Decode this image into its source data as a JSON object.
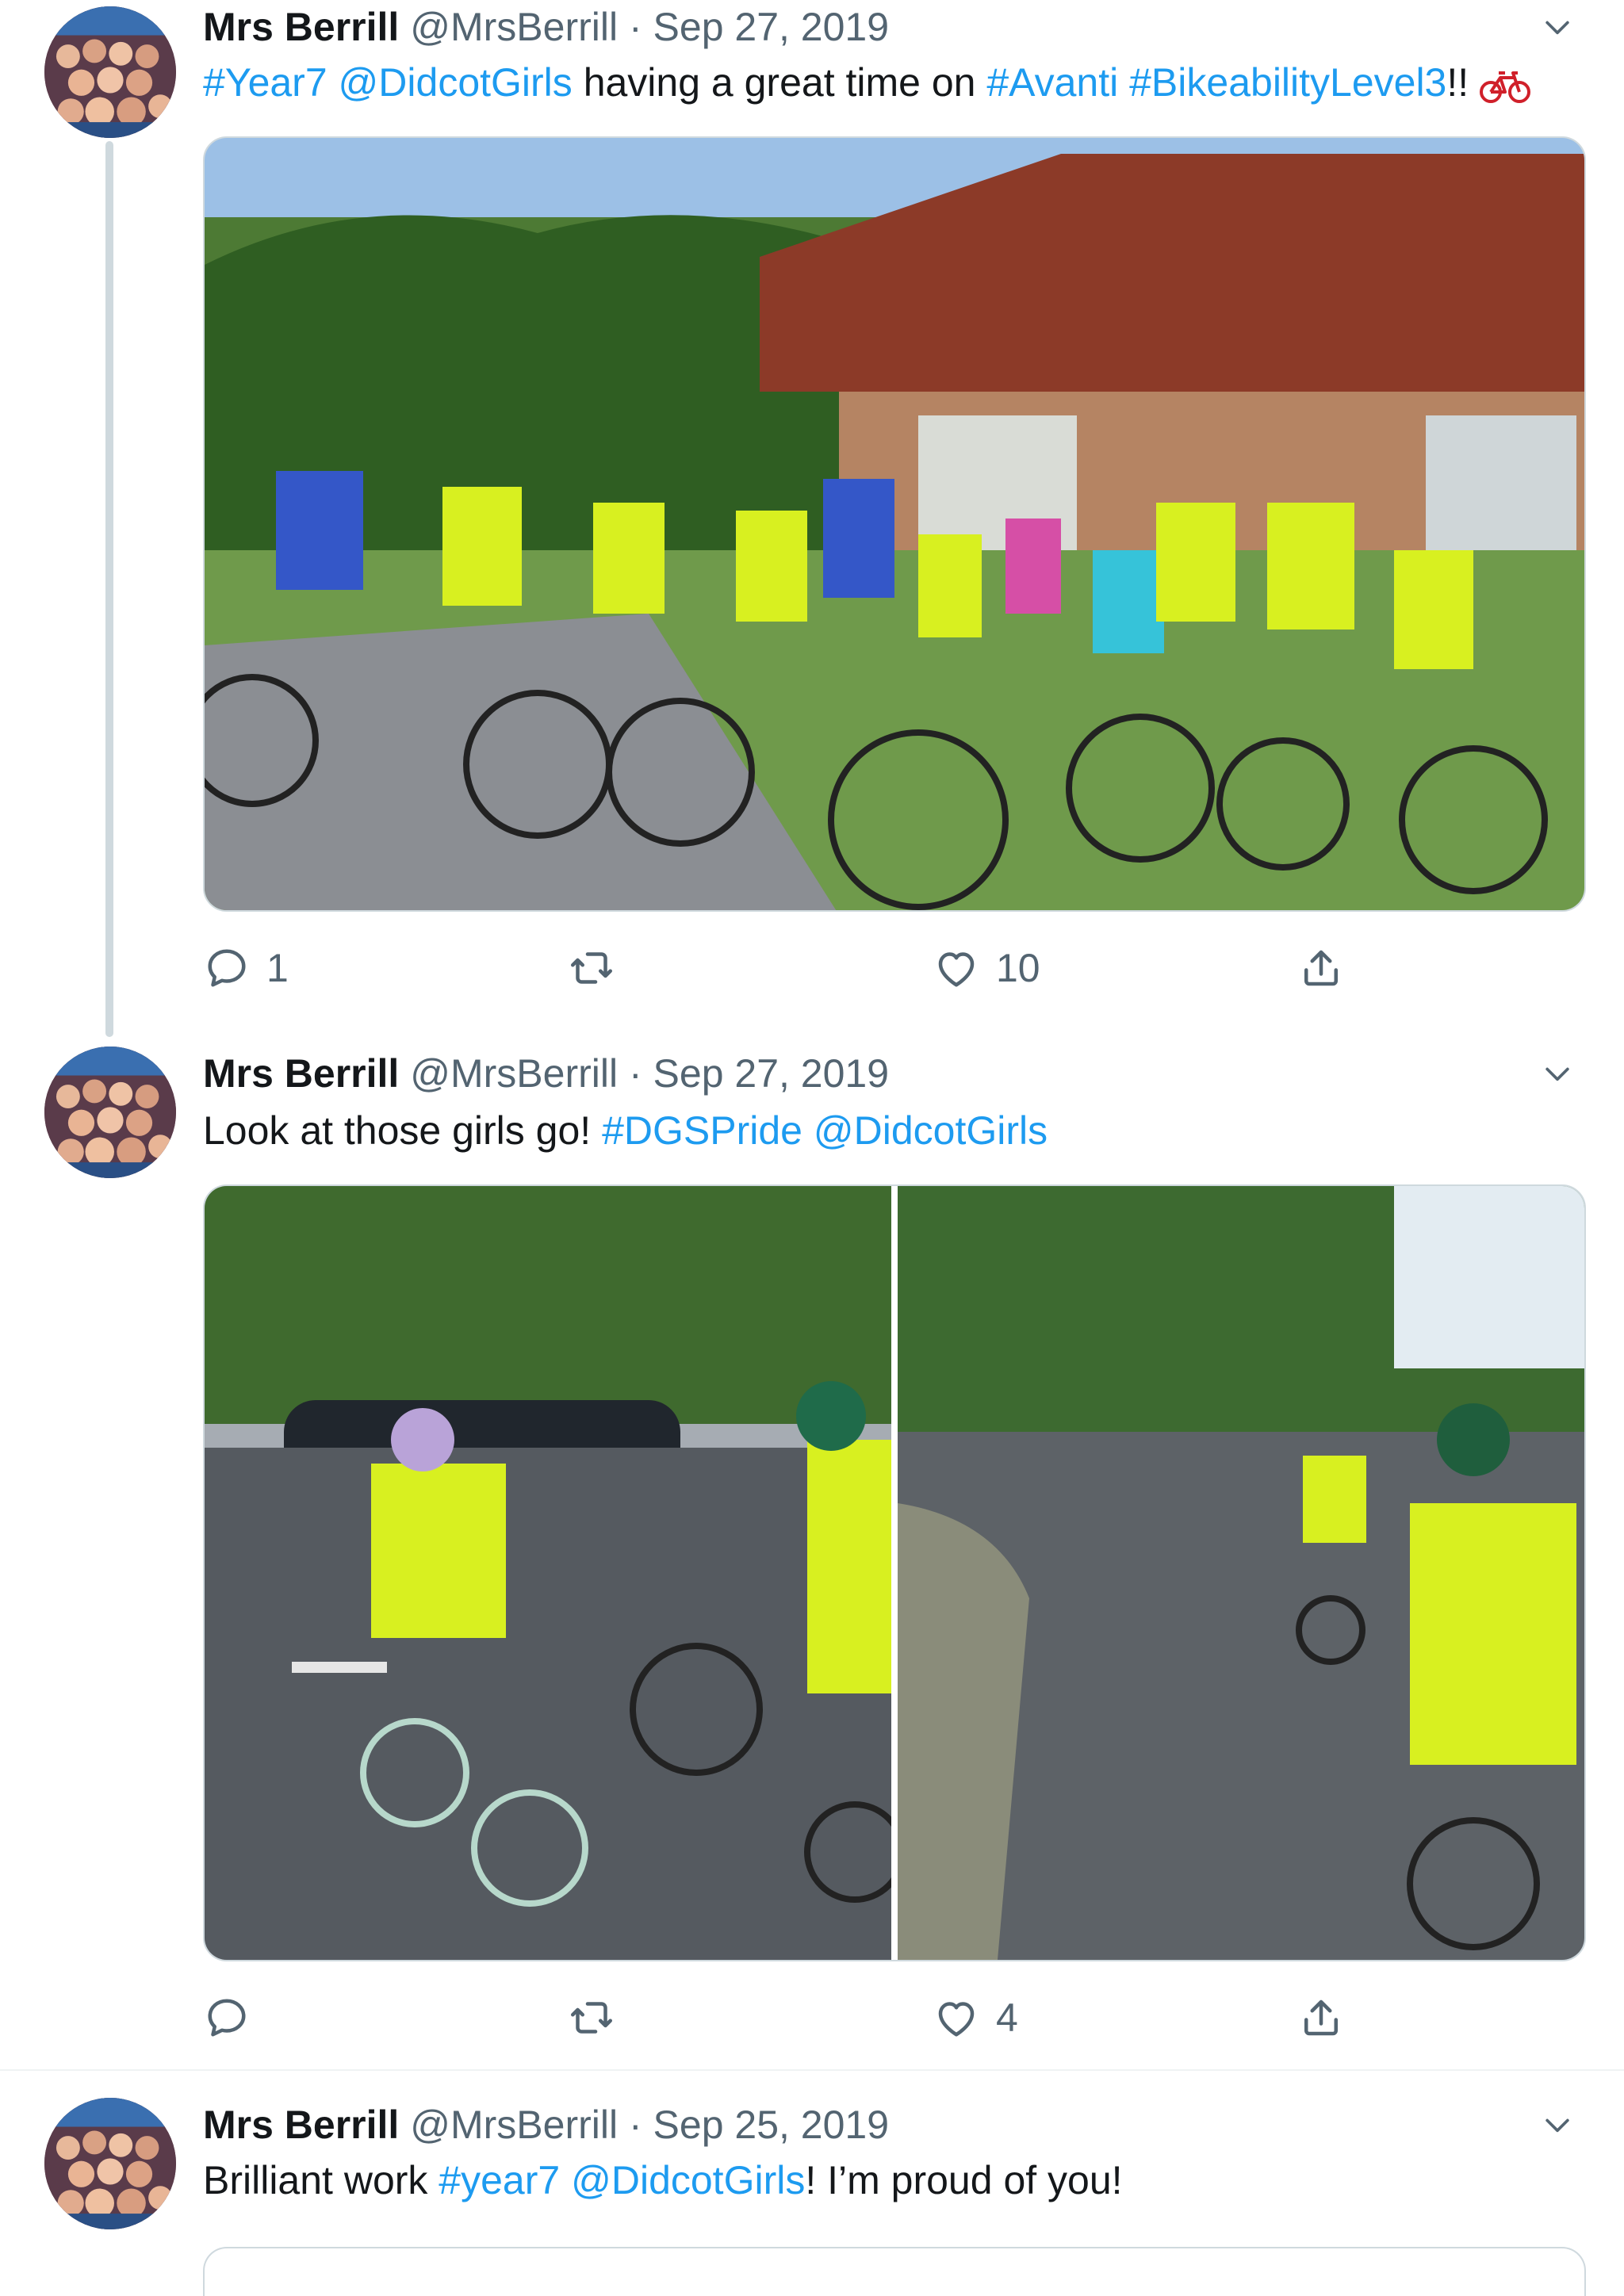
{
  "tweets": [
    {
      "author_name": "Mrs Berrill",
      "handle": "@MrsBerrill",
      "separator": "·",
      "date": "Sep 27, 2019",
      "text_parts": [
        "#Year7",
        " ",
        "@DidcotGirls",
        " having a great time on ",
        "#Avanti",
        " ",
        "#BikeabilityLevel3",
        "!!"
      ],
      "reply_count": "1",
      "retweet_count": "",
      "like_count": "10"
    },
    {
      "author_name": "Mrs Berrill",
      "handle": "@MrsBerrill",
      "separator": "·",
      "date": "Sep 27, 2019",
      "text_parts": [
        "Look at those girls go! ",
        "#DGSPride",
        " ",
        "@DidcotGirls"
      ],
      "reply_count": "",
      "retweet_count": "",
      "like_count": "4"
    },
    {
      "author_name": "Mrs Berrill",
      "handle": "@MrsBerrill",
      "separator": "·",
      "date": "Sep 25, 2019",
      "text_parts": [
        "Brilliant work ",
        "#year7",
        " ",
        "@DidcotGirls",
        "! I’m proud of you!"
      ]
    }
  ],
  "colors": {
    "link": "#1d9bf0",
    "muted": "#536471",
    "vest": "#d8f020"
  },
  "icons": [
    "chevron-down-icon",
    "reply-icon",
    "retweet-icon",
    "like-icon",
    "share-icon",
    "bicycle-emoji-icon"
  ]
}
